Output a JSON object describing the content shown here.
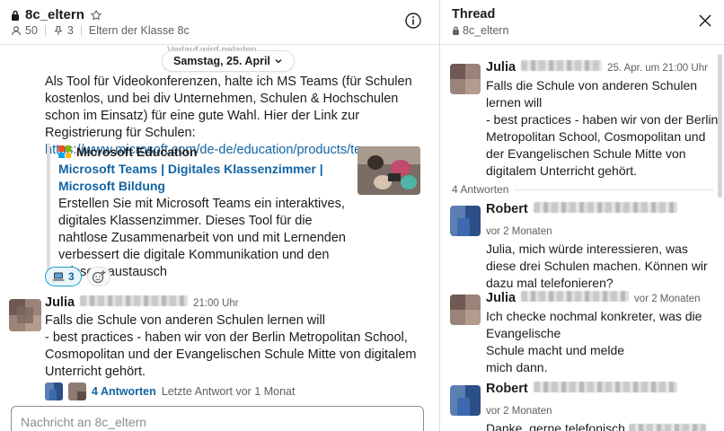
{
  "channel": {
    "name": "8c_eltern",
    "members": "50",
    "pins": "3",
    "description": "Eltern der Klasse 8c"
  },
  "history_loading": "Verlauf wird geladen",
  "date_divider": "Samstag, 25. April",
  "message1": {
    "text": "Als Tool für Videokonferenzen, halte ich MS Teams (für Schulen kostenlos, und bei div Unternehmen, Schulen & Hochschulen schon im Einsatz) für eine gute Wahl. Hier der Link zur Registrierung für Schulen:",
    "link": "https://www.microsoft.com/de-de/education/products/teams",
    "unfurl": {
      "source": "Microsoft Education",
      "title": "Microsoft Teams | Digitales Klassenzimmer | Microsoft Bildung",
      "description": "Erstellen Sie mit Microsoft Teams ein interaktives, digitales Klassenzimmer. Dieses Tool für die nahtlose Zusammenarbeit von und mit Lernenden verbessert die digitale Kommunikation und den Wissensaustausch"
    },
    "reaction_count": "3"
  },
  "message2": {
    "sender": "Julia",
    "time": "21:00 Uhr",
    "lines": [
      "Falls die Schule von anderen Schulen lernen will",
      "- best practices - haben wir von der Berlin Metropolitan School, Cosmopolitan und der Evangelischen Schule Mitte von digitalem Unterricht gehört."
    ],
    "thread_replies": "4 Antworten",
    "thread_last": "Letzte Antwort vor 1 Monat"
  },
  "composer": {
    "placeholder": "Nachricht an 8c_eltern"
  },
  "thread": {
    "title": "Thread",
    "channel": "8c_eltern",
    "parent": {
      "sender": "Julia",
      "time": "25. Apr. um 21:00 Uhr",
      "lines": [
        "Falls die Schule von anderen Schulen lernen will",
        "- best practices - haben wir von der Berlin Metropolitan School, Cosmopolitan und der Evangelischen Schule Mitte von digitalem Unterricht gehört."
      ]
    },
    "replies_label": "4 Antworten",
    "replies": [
      {
        "sender": "Robert",
        "time": "vor 2 Monaten",
        "text": "Julia, mich würde interessieren, was diese drei Schulen machen. Können wir dazu mal telefonieren?"
      },
      {
        "sender": "Julia",
        "time": "vor 2 Monaten",
        "lines": [
          "Ich checke nochmal konkreter, was die Evangelische",
          "Schule macht und melde",
          "mich dann."
        ]
      },
      {
        "sender": "Robert",
        "time": "vor 2 Monaten",
        "text": "Danke, gerne telefonisch"
      }
    ]
  },
  "colors": {
    "link": "#1264a3",
    "ms_red": "#f25022",
    "ms_green": "#7fba00",
    "ms_blue": "#00a4ef",
    "ms_yellow": "#ffb900"
  }
}
